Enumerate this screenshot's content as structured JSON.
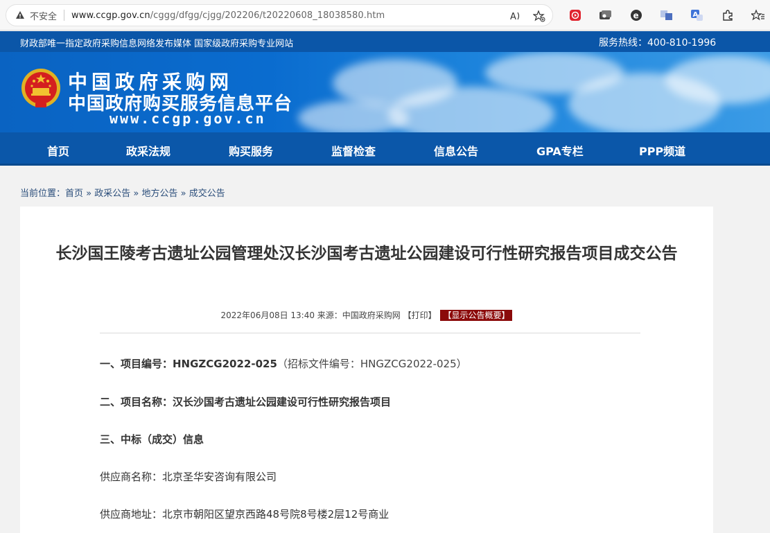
{
  "browser": {
    "insecure_label": "不安全",
    "url_host": "www.ccgp.gov.cn",
    "url_path": "/cggg/dfgg/cjgg/202206/t20220608_18038580.htm"
  },
  "topstrip": {
    "left_text": "财政部唯一指定政府采购信息网络发布媒体 国家级政府采购专业网站",
    "hotline": "服务热线：400-810-1996"
  },
  "banner": {
    "line1": "中国政府采购网",
    "line2": "中国政府购买服务信息平台",
    "line3": "www.ccgp.gov.cn"
  },
  "nav": {
    "items": [
      "首页",
      "政采法规",
      "购买服务",
      "监督检查",
      "信息公告",
      "GPA专栏",
      "PPP频道"
    ]
  },
  "breadcrumb": {
    "prefix": "当前位置：",
    "items": [
      "首页",
      "政采公告",
      "地方公告",
      "成交公告"
    ]
  },
  "article": {
    "title": "长沙国王陵考古遗址公园管理处汉长沙国考古遗址公园建设可行性研究报告项目成交公告",
    "meta_text": "2022年06月08日 13:40 来源：中国政府采购网 【打印】",
    "summary_badge": "【显示公告概要】",
    "p1_label": "一、项目编号：HNGZCG2022-025",
    "p1_extra": "（招标文件编号：HNGZCG2022-025）",
    "p2": "二、项目名称：汉长沙国考古遗址公园建设可行性研究报告项目",
    "p3": "三、中标（成交）信息",
    "p4": "供应商名称：北京圣华安咨询有限公司",
    "p5": "供应商地址：北京市朝阳区望京西路48号院8号楼2层12号商业"
  }
}
